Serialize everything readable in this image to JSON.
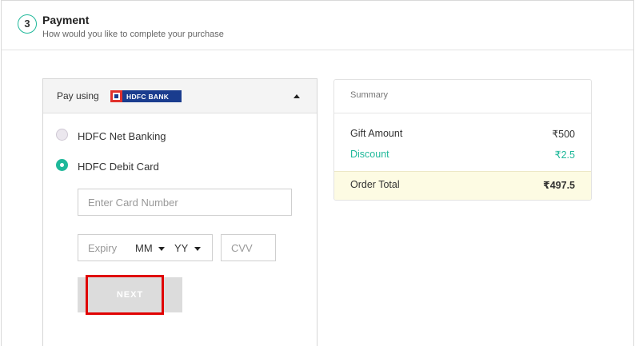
{
  "header": {
    "step_number": "3",
    "title": "Payment",
    "subtitle": "How would you like to complete your purchase"
  },
  "payment_panel": {
    "pay_using_label": "Pay using",
    "bank_logo_text": "HDFC BANK",
    "options": [
      {
        "label": "HDFC Net Banking",
        "selected": false
      },
      {
        "label": "HDFC Debit Card",
        "selected": true
      }
    ],
    "card_number": {
      "placeholder": "Enter Card Number",
      "value": ""
    },
    "expiry": {
      "label": "Expiry",
      "month": "MM",
      "year": "YY"
    },
    "cvv": {
      "placeholder": "CVV",
      "value": ""
    },
    "next_label": "NEXT"
  },
  "summary": {
    "title": "Summary",
    "gift_amount_label": "Gift Amount",
    "gift_amount_value": "₹500",
    "discount_label": "Discount",
    "discount_value": "₹2.5",
    "order_total_label": "Order Total",
    "order_total_value": "₹497.5"
  },
  "colors": {
    "accent": "#1fb89a",
    "highlight": "#e00000",
    "bank_blue": "#1a3c8e",
    "bank_red": "#e0312c",
    "total_bg": "#fdfbe3"
  },
  "icons": {
    "collapse": "chevron-up-icon",
    "dropdown": "caret-down-icon"
  }
}
